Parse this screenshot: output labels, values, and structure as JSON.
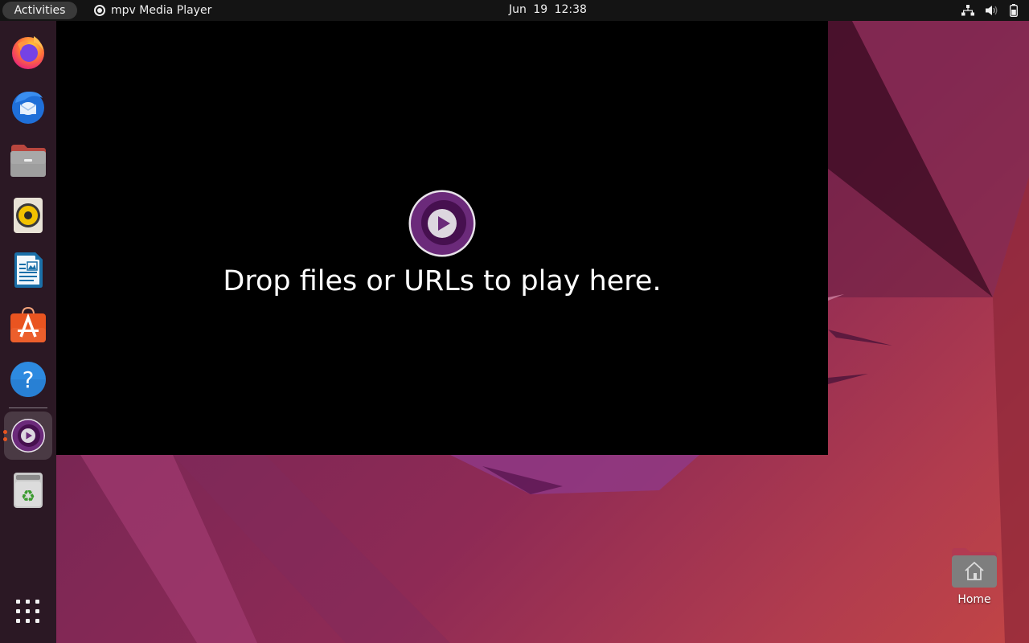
{
  "topbar": {
    "activities_label": "Activities",
    "app_name": "mpv Media Player",
    "clock": "Jun 19  12:38",
    "tray": [
      "network-icon",
      "volume-icon",
      "battery-icon"
    ]
  },
  "dock": {
    "items": [
      {
        "name": "Firefox Web Browser",
        "icon": "firefox-icon"
      },
      {
        "name": "Thunderbird Mail",
        "icon": "thunderbird-icon"
      },
      {
        "name": "Files",
        "icon": "files-icon"
      },
      {
        "name": "Rhythmbox",
        "icon": "rhythmbox-icon"
      },
      {
        "name": "LibreOffice Writer",
        "icon": "writer-icon"
      },
      {
        "name": "Ubuntu Software",
        "icon": "software-icon"
      },
      {
        "name": "Help",
        "icon": "help-icon"
      },
      {
        "name": "mpv Media Player",
        "icon": "mpv-icon",
        "running": true,
        "active": true
      },
      {
        "name": "Trash",
        "icon": "trash-icon"
      }
    ],
    "show_apps": "Show Applications"
  },
  "mpv": {
    "message": "Drop files or URLs to play here."
  },
  "desktop": {
    "home_label": "Home"
  },
  "colors": {
    "topbar_bg": "#141414",
    "dock_bg": "#2b1824",
    "accent_orange": "#e95420",
    "mpv_purple": "#6b2a7a"
  }
}
